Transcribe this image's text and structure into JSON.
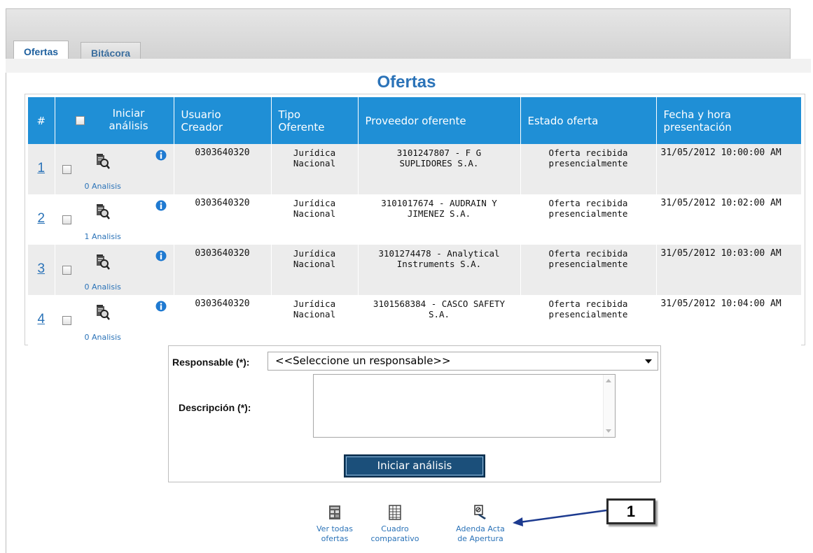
{
  "tabs": [
    {
      "label": "Ofertas",
      "active": true
    },
    {
      "label": "Bitácora",
      "active": false
    }
  ],
  "page_title": "Ofertas",
  "table": {
    "headers": {
      "num": "#",
      "iniciar_l1": "Iniciar",
      "iniciar_l2": "análisis",
      "usuario_l1": "Usuario",
      "usuario_l2": "Creador",
      "tipo_l1": "Tipo",
      "tipo_l2": "Oferente",
      "proveedor": "Proveedor oferente",
      "estado": "Estado oferta",
      "fecha_l1": "Fecha y hora",
      "fecha_l2": "presentación"
    },
    "rows": [
      {
        "num": "1",
        "analisis": "0 Analisis",
        "usuario": "0303640320",
        "tipo_l1": "Jurídica",
        "tipo_l2": "Nacional",
        "prov_l1": "3101247807 - F G",
        "prov_l2": "SUPLIDORES S.A.",
        "estado_l1": "Oferta recibida",
        "estado_l2": "presencialmente",
        "fecha": "31/05/2012 10:00:00 AM"
      },
      {
        "num": "2",
        "analisis": "1 Analisis",
        "usuario": "0303640320",
        "tipo_l1": "Jurídica",
        "tipo_l2": "Nacional",
        "prov_l1": "3101017674 - AUDRAIN Y",
        "prov_l2": "JIMENEZ S.A.",
        "estado_l1": "Oferta recibida",
        "estado_l2": "presencialmente",
        "fecha": "31/05/2012 10:02:00 AM"
      },
      {
        "num": "3",
        "analisis": "0 Analisis",
        "usuario": "0303640320",
        "tipo_l1": "Jurídica",
        "tipo_l2": "Nacional",
        "prov_l1": "3101274478 - Analytical",
        "prov_l2": "Instruments S.A.",
        "estado_l1": "Oferta recibida",
        "estado_l2": "presencialmente",
        "fecha": "31/05/2012 10:03:00 AM"
      },
      {
        "num": "4",
        "analisis": "0 Analisis",
        "usuario": "0303640320",
        "tipo_l1": "Jurídica",
        "tipo_l2": "Nacional",
        "prov_l1": "3101568384 - CASCO SAFETY",
        "prov_l2": "S.A.",
        "estado_l1": "Oferta recibida",
        "estado_l2": "presencialmente",
        "fecha": "31/05/2012 10:04:00 AM"
      }
    ]
  },
  "form": {
    "responsable_label": "Responsable (*):",
    "responsable_value": "<<Seleccione un responsable>>",
    "descripcion_label": "Descripción (*):",
    "descripcion_value": "",
    "submit_label": "Iniciar análisis"
  },
  "actions": [
    {
      "line1": "Ver todas",
      "line2": "ofertas",
      "icon": "grid-document-icon"
    },
    {
      "line1": "Cuadro",
      "line2": "comparativo",
      "icon": "table-document-icon"
    },
    {
      "line1": "Adenda Acta",
      "line2": "de Apertura",
      "icon": "document-edit-icon"
    }
  ],
  "callout": {
    "label": "1"
  },
  "colors": {
    "header_bg": "#1f8fd6",
    "title": "#2b73b8",
    "button_bg": "#1b4f7a"
  }
}
